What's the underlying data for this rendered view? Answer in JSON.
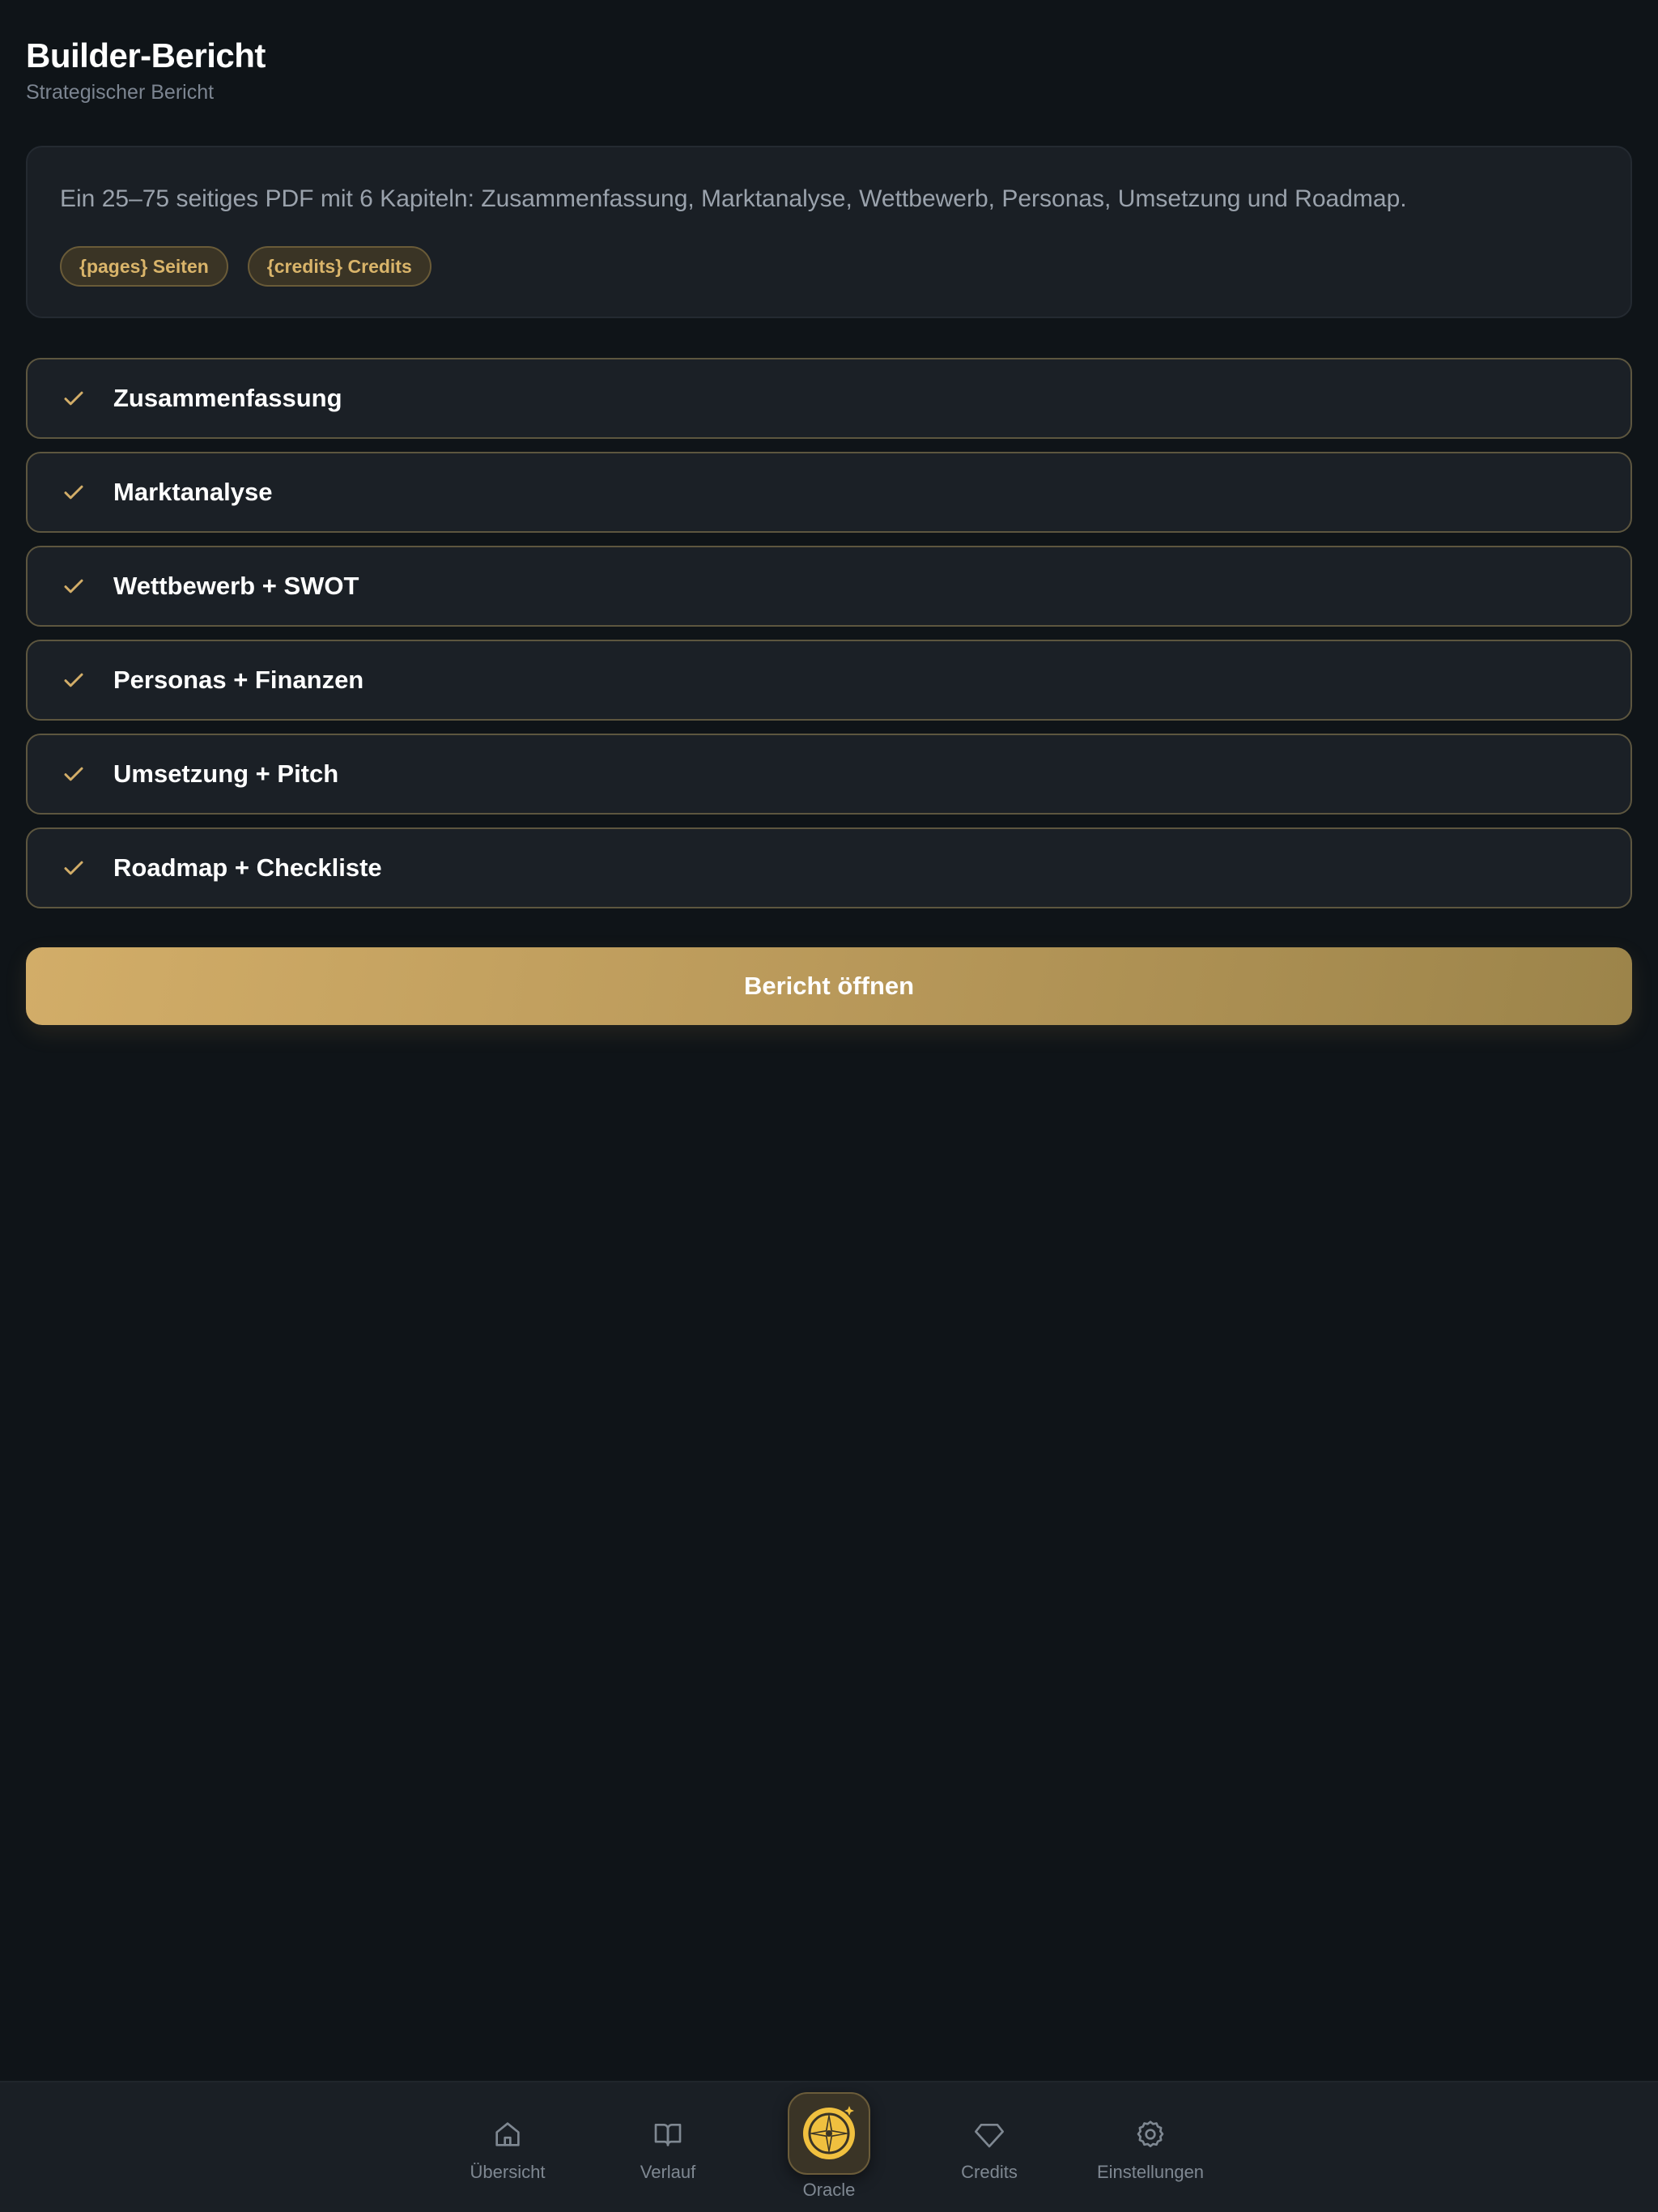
{
  "header": {
    "title": "Builder-Bericht",
    "subtitle": "Strategischer Bericht"
  },
  "info": {
    "description": "Ein 25–75 seitiges PDF mit 6 Kapiteln: Zusammenfassung, Marktanalyse, Wettbewerb, Personas, Umsetzung und Roadmap.",
    "pills": [
      "{pages} Seiten",
      "{credits} Credits"
    ]
  },
  "chapters": [
    {
      "label": "Zusammenfassung",
      "icon": "check-icon"
    },
    {
      "label": "Marktanalyse",
      "icon": "check-icon"
    },
    {
      "label": "Wettbewerb + SWOT",
      "icon": "check-icon"
    },
    {
      "label": "Personas + Finanzen",
      "icon": "check-icon"
    },
    {
      "label": "Umsetzung + Pitch",
      "icon": "check-icon"
    },
    {
      "label": "Roadmap + Checkliste",
      "icon": "check-icon"
    }
  ],
  "cta": {
    "label": "Bericht öffnen"
  },
  "nav": {
    "items": [
      {
        "label": "Übersicht",
        "icon": "home-icon"
      },
      {
        "label": "Verlauf",
        "icon": "book-icon"
      },
      {
        "label": "Oracle",
        "icon": "compass-icon"
      },
      {
        "label": "Credits",
        "icon": "diamond-icon"
      },
      {
        "label": "Einstellungen",
        "icon": "gear-icon"
      }
    ]
  },
  "colors": {
    "background": "#0f1418",
    "card": "#1b2026",
    "accent": "#d2ad68",
    "muted_text": "#7c8591"
  }
}
